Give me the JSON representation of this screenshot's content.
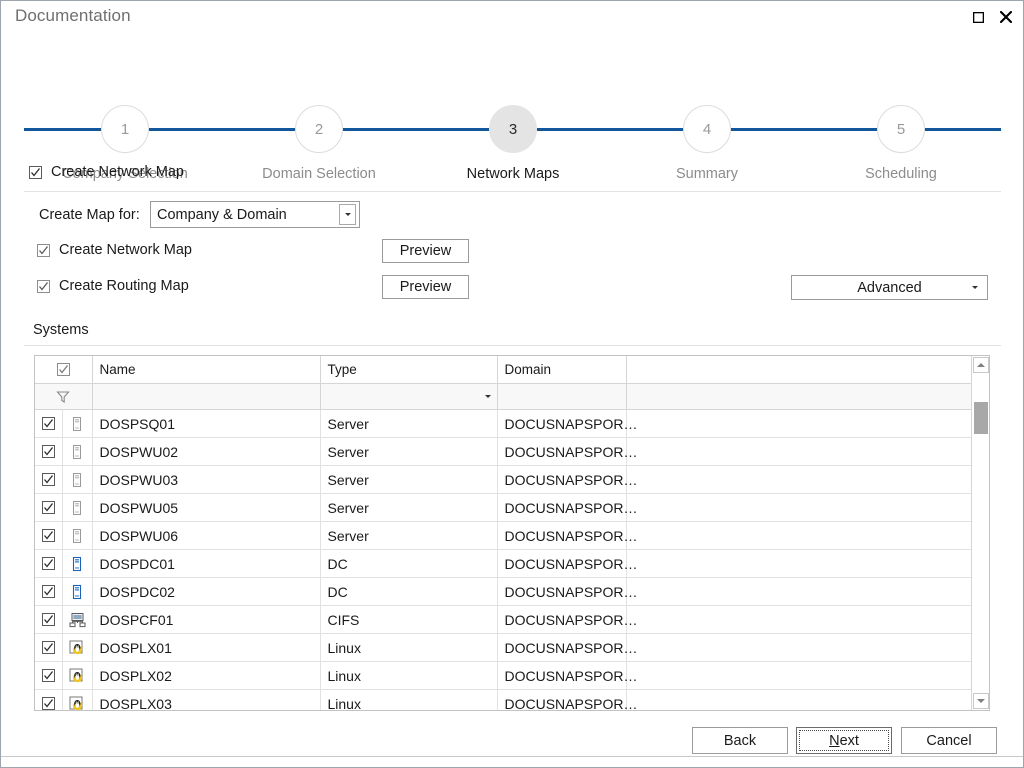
{
  "window": {
    "title": "Documentation",
    "controls": [
      {
        "name": "maximize",
        "glyph": "maximize-icon"
      },
      {
        "name": "close",
        "glyph": "close-icon"
      }
    ]
  },
  "stepper": {
    "active_index": 2,
    "steps": [
      {
        "number": "1",
        "label": "Company Selection"
      },
      {
        "number": "2",
        "label": "Domain Selection"
      },
      {
        "number": "3",
        "label": "Network Maps"
      },
      {
        "number": "4",
        "label": "Summary"
      },
      {
        "number": "5",
        "label": "Scheduling"
      }
    ]
  },
  "options": {
    "master_checkbox": {
      "label": "Create Network Map",
      "checked": true
    },
    "map_for_label": "Create Map for:",
    "map_for_value": "Company & Domain",
    "map_for_options": [
      "Company & Domain"
    ],
    "network_map": {
      "label": "Create Network Map",
      "checked": true,
      "button": "Preview"
    },
    "routing_map": {
      "label": "Create Routing Map",
      "checked": true,
      "button": "Preview"
    },
    "advanced_label": "Advanced"
  },
  "systems": {
    "section_label": "Systems",
    "columns": [
      "",
      "",
      "Name",
      "Type",
      "Domain",
      ""
    ],
    "filter_placeholder": "",
    "rows": [
      {
        "checked": true,
        "icon": "server-icon",
        "name": "DOSPSQ01",
        "type": "Server",
        "domain": "DOCUSNAPSPOR…"
      },
      {
        "checked": true,
        "icon": "server-icon",
        "name": "DOSPWU02",
        "type": "Server",
        "domain": "DOCUSNAPSPOR…"
      },
      {
        "checked": true,
        "icon": "server-icon",
        "name": "DOSPWU03",
        "type": "Server",
        "domain": "DOCUSNAPSPOR…"
      },
      {
        "checked": true,
        "icon": "server-icon",
        "name": "DOSPWU05",
        "type": "Server",
        "domain": "DOCUSNAPSPOR…"
      },
      {
        "checked": true,
        "icon": "server-icon",
        "name": "DOSPWU06",
        "type": "Server",
        "domain": "DOCUSNAPSPOR…"
      },
      {
        "checked": true,
        "icon": "domain-controller-icon",
        "name": "DOSPDC01",
        "type": "DC",
        "domain": "DOCUSNAPSPOR…"
      },
      {
        "checked": true,
        "icon": "domain-controller-icon",
        "name": "DOSPDC02",
        "type": "DC",
        "domain": "DOCUSNAPSPOR…"
      },
      {
        "checked": true,
        "icon": "cifs-share-icon",
        "name": "DOSPCF01",
        "type": "CIFS",
        "domain": "DOCUSNAPSPOR…"
      },
      {
        "checked": true,
        "icon": "linux-penguin-icon",
        "name": "DOSPLX01",
        "type": "Linux",
        "domain": "DOCUSNAPSPOR…"
      },
      {
        "checked": true,
        "icon": "linux-penguin-icon",
        "name": "DOSPLX02",
        "type": "Linux",
        "domain": "DOCUSNAPSPOR…"
      },
      {
        "checked": true,
        "icon": "linux-penguin-icon",
        "name": "DOSPLX03",
        "type": "Linux",
        "domain": "DOCUSNAPSPOR…"
      }
    ]
  },
  "footer": {
    "back": "Back",
    "next_accel": "N",
    "next_rest": "ext",
    "cancel": "Cancel"
  },
  "colors": {
    "accent": "#12569c",
    "active_circle": "#e4e4e4",
    "muted_text": "#8c8c8c",
    "border": "#c3c3c3"
  }
}
